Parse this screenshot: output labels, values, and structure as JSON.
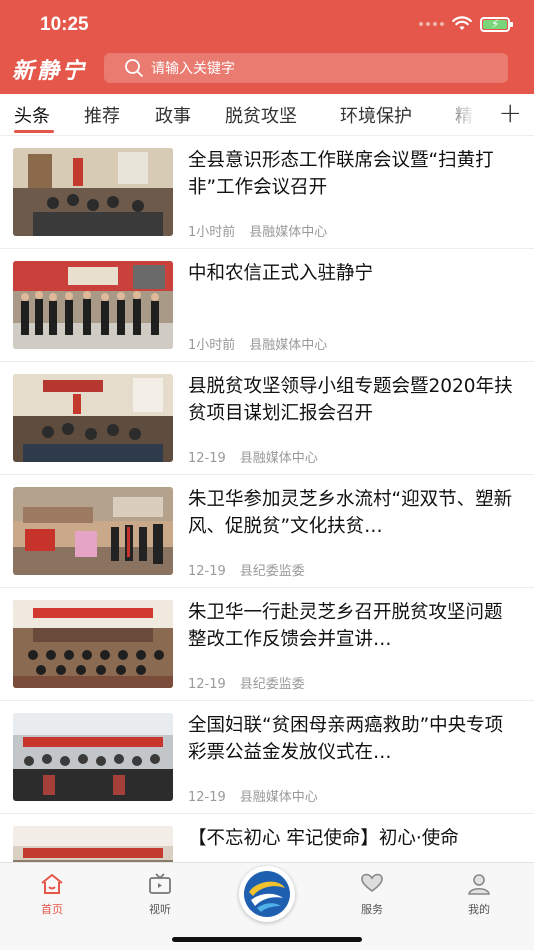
{
  "status": {
    "time": "10:25"
  },
  "header": {
    "logo_text": "新静宁",
    "search_placeholder": "请输入关键字"
  },
  "tabs": [
    {
      "label": "头条",
      "active": true
    },
    {
      "label": "推荐"
    },
    {
      "label": "政事"
    },
    {
      "label": "脱贫攻坚"
    },
    {
      "label": "环境保护"
    },
    {
      "label": "精准"
    }
  ],
  "add_tab_icon": "plus-icon",
  "articles": [
    {
      "title": "全县意识形态工作联席会议暨“扫黄打非”工作会议召开",
      "time": "1小时前",
      "source": "县融媒体中心",
      "thumb": "meeting-room"
    },
    {
      "title": "中和农信正式入驻静宁",
      "time": "1小时前",
      "source": "县融媒体中心",
      "thumb": "ribbon-ceremony"
    },
    {
      "title": "县脱贫攻坚领导小组专题会暨2020年扶贫项目谋划汇报会召开",
      "time": "12-19",
      "source": "县融媒体中心",
      "thumb": "meeting-room"
    },
    {
      "title": "朱卫华参加灵芝乡水流村“迎双节、塑新风、促脱贫”文化扶贫…",
      "time": "12-19",
      "source": "县纪委监委",
      "thumb": "outdoor-event"
    },
    {
      "title": "朱卫华一行赴灵芝乡召开脱贫攻坚问题整改工作反馈会并宣讲…",
      "time": "12-19",
      "source": "县纪委监委",
      "thumb": "auditorium"
    },
    {
      "title": "全国妇联“贫困母亲两癌救助”中央专项彩票公益金发放仪式在…",
      "time": "12-19",
      "source": "县融媒体中心",
      "thumb": "auditorium"
    },
    {
      "title": "【不忘初心 牢记使命】初心·使命",
      "time": "",
      "source": "",
      "thumb": "auditorium"
    }
  ],
  "tabbar": [
    {
      "label": "首页",
      "icon": "home-icon",
      "active": true
    },
    {
      "label": "视听",
      "icon": "tv-icon"
    },
    {
      "label": "",
      "icon": "app-logo"
    },
    {
      "label": "服务",
      "icon": "heart-hands-icon"
    },
    {
      "label": "我的",
      "icon": "user-icon"
    }
  ],
  "colors": {
    "brand": "#e5574a",
    "tab_active": "#e5574a",
    "meta_gray": "#9a9a9a"
  }
}
